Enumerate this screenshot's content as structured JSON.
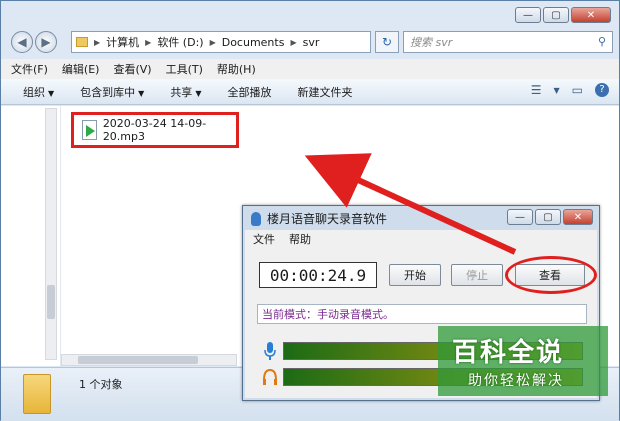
{
  "explorer": {
    "breadcrumbs": [
      "计算机",
      "软件 (D:)",
      "Documents",
      "svr"
    ],
    "search_placeholder": "搜索 svr",
    "menu": [
      "文件(F)",
      "编辑(E)",
      "查看(V)",
      "工具(T)",
      "帮助(H)"
    ],
    "toolbar": [
      "组织",
      "包含到库中",
      "共享",
      "全部播放",
      "新建文件夹"
    ],
    "file_name": "2020-03-24 14-09-20.mp3",
    "status_count": "1 个对象"
  },
  "recorder": {
    "title": "楼月语音聊天录音软件",
    "menu": [
      "文件",
      "帮助"
    ],
    "timer": "00:00:24.9",
    "buttons": {
      "start": "开始",
      "stop": "停止",
      "view": "查看"
    },
    "mode_text": "当前模式：手动录音模式。"
  },
  "watermark": {
    "title": "百科全说",
    "subtitle": "助你轻松解决"
  },
  "colors": {
    "highlight_red": "#e0201f",
    "level_green": "#1c6b15",
    "watermark_green": "#2f9a3a"
  }
}
